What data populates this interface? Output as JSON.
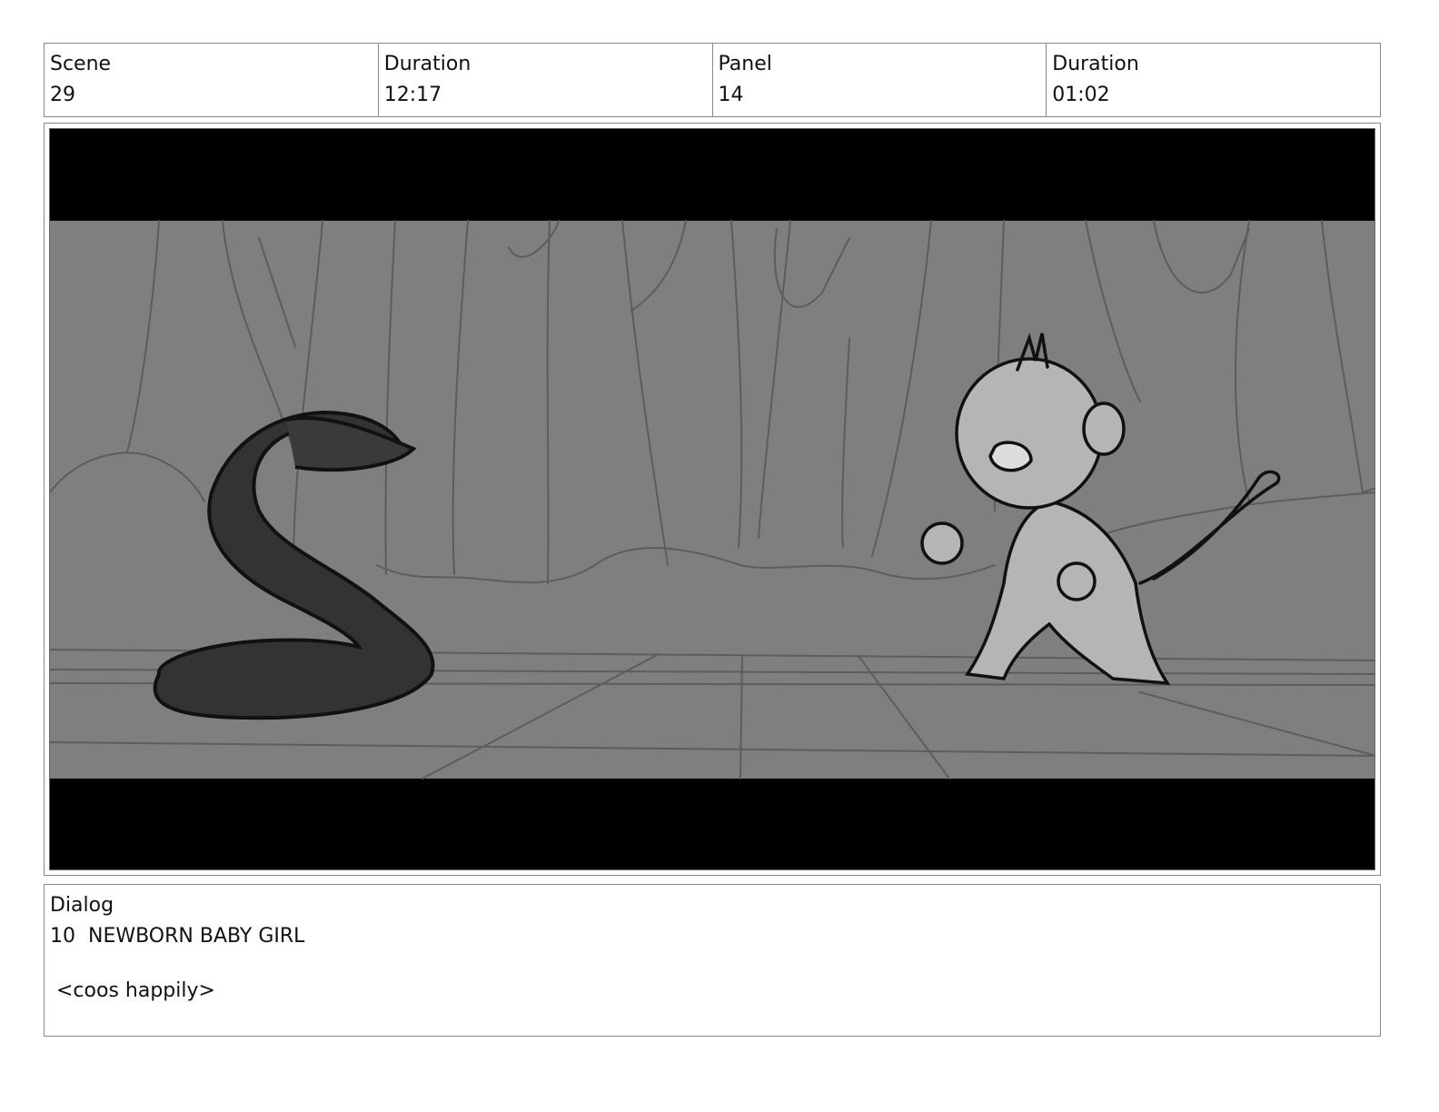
{
  "header": {
    "scene_label": "Scene",
    "scene_value": "29",
    "scene_duration_label": "Duration",
    "scene_duration_value": "12:17",
    "panel_label": "Panel",
    "panel_value": "14",
    "panel_duration_label": "Duration",
    "panel_duration_value": "01:02"
  },
  "panel_image": {
    "description_icon": "storyboard-sketch-image"
  },
  "dialog": {
    "label": "Dialog",
    "speaker_line": "10  NEWBORN BABY GIRL",
    "line": " <coos happily>"
  }
}
